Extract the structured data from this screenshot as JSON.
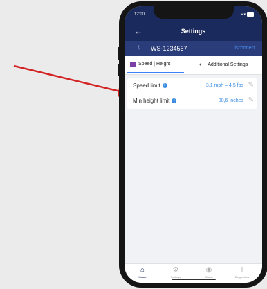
{
  "status_bar": {
    "time": "12:00",
    "signal_icon": "signal-icon",
    "battery_icon": "battery-icon"
  },
  "header": {
    "title": "Settings",
    "back_icon": "arrow-left-icon"
  },
  "device": {
    "bluetooth_icon": "bluetooth-icon",
    "name": "WS-1234567",
    "disconnect_label": "Disconnect"
  },
  "tabs": [
    {
      "label": "Speed | Height",
      "active": true,
      "icon": "speed-height-icon"
    },
    {
      "label": "Additional Settings",
      "active": false,
      "icon": "settings-toggle-icon"
    }
  ],
  "settings": [
    {
      "label": "Speed limit",
      "value": "3.1 mph – 4.5 fps",
      "info_icon": "info-icon",
      "edit_icon": "pencil-icon"
    },
    {
      "label": "Min height limit",
      "value": "88,6 Inches",
      "info_icon": "info-icon",
      "edit_icon": "pencil-icon"
    }
  ],
  "nav": [
    {
      "label": "Home",
      "icon": "home-icon",
      "active": true
    },
    {
      "label": "Settings",
      "icon": "gear-icon",
      "active": false
    },
    {
      "label": "Status",
      "icon": "eye-icon",
      "active": false
    },
    {
      "label": "Diagnostics",
      "icon": "stethoscope-icon",
      "active": false
    }
  ],
  "colors": {
    "header": "#1b2a5c",
    "device_row": "#2a3d7a",
    "accent": "#3b8de0",
    "annotation_arrow": "#d32525"
  }
}
